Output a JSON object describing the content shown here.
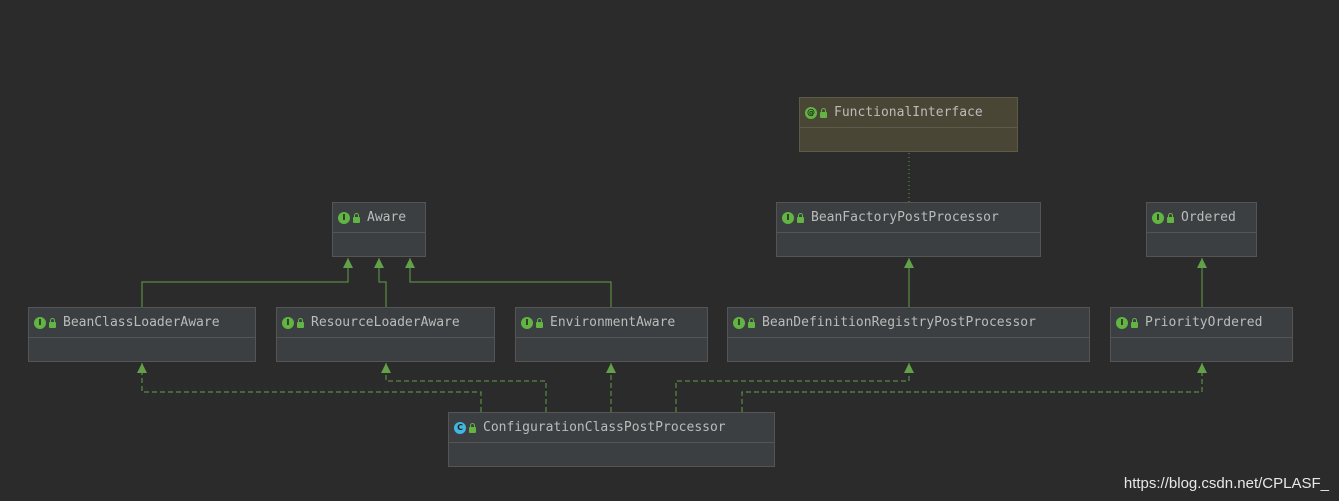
{
  "diagram": {
    "nodes": [
      {
        "id": "FunctionalInterface",
        "label": "FunctionalInterface",
        "kind": "annotation",
        "badge": "@"
      },
      {
        "id": "Aware",
        "label": "Aware",
        "kind": "interface",
        "badge": "I"
      },
      {
        "id": "BeanFactoryPostProcessor",
        "label": "BeanFactoryPostProcessor",
        "kind": "interface",
        "badge": "I"
      },
      {
        "id": "Ordered",
        "label": "Ordered",
        "kind": "interface",
        "badge": "I"
      },
      {
        "id": "BeanClassLoaderAware",
        "label": "BeanClassLoaderAware",
        "kind": "interface",
        "badge": "I"
      },
      {
        "id": "ResourceLoaderAware",
        "label": "ResourceLoaderAware",
        "kind": "interface",
        "badge": "I"
      },
      {
        "id": "EnvironmentAware",
        "label": "EnvironmentAware",
        "kind": "interface",
        "badge": "I"
      },
      {
        "id": "BeanDefinitionRegistryPostProcessor",
        "label": "BeanDefinitionRegistryPostProcessor",
        "kind": "interface",
        "badge": "I"
      },
      {
        "id": "PriorityOrdered",
        "label": "PriorityOrdered",
        "kind": "interface",
        "badge": "I"
      },
      {
        "id": "ConfigurationClassPostProcessor",
        "label": "ConfigurationClassPostProcessor",
        "kind": "class",
        "badge": "C"
      }
    ],
    "edges": [
      {
        "from": "BeanFactoryPostProcessor",
        "to": "FunctionalInterface",
        "type": "annotated"
      },
      {
        "from": "BeanClassLoaderAware",
        "to": "Aware",
        "type": "extends"
      },
      {
        "from": "ResourceLoaderAware",
        "to": "Aware",
        "type": "extends"
      },
      {
        "from": "EnvironmentAware",
        "to": "Aware",
        "type": "extends"
      },
      {
        "from": "BeanDefinitionRegistryPostProcessor",
        "to": "BeanFactoryPostProcessor",
        "type": "extends"
      },
      {
        "from": "PriorityOrdered",
        "to": "Ordered",
        "type": "extends"
      },
      {
        "from": "ConfigurationClassPostProcessor",
        "to": "BeanClassLoaderAware",
        "type": "implements"
      },
      {
        "from": "ConfigurationClassPostProcessor",
        "to": "ResourceLoaderAware",
        "type": "implements"
      },
      {
        "from": "ConfigurationClassPostProcessor",
        "to": "EnvironmentAware",
        "type": "implements"
      },
      {
        "from": "ConfigurationClassPostProcessor",
        "to": "BeanDefinitionRegistryPostProcessor",
        "type": "implements"
      },
      {
        "from": "ConfigurationClassPostProcessor",
        "to": "PriorityOrdered",
        "type": "implements"
      }
    ]
  },
  "colors": {
    "edge": "#62a04a",
    "background": "#2b2b2b"
  },
  "watermark": "https://blog.csdn.net/CPLASF_"
}
